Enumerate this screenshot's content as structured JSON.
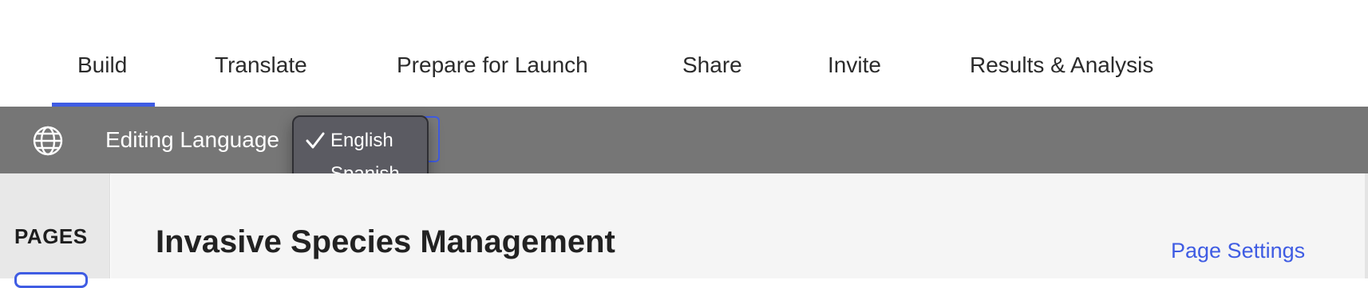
{
  "tabs": [
    "Build",
    "Translate",
    "Prepare for Launch",
    "Share",
    "Invite",
    "Results & Analysis"
  ],
  "active_tab": "Build",
  "language_bar": {
    "icon": "globe-icon",
    "label": "Editing Language",
    "options": [
      "English",
      "Spanish"
    ],
    "selected": "English"
  },
  "sidebar": {
    "title": "PAGES"
  },
  "main": {
    "page_title": "Invasive Species Management",
    "settings_link": "Page Settings"
  },
  "colors": {
    "accent": "#3f5ce3",
    "bar": "#767676",
    "dropdown": "#5b5b62"
  }
}
